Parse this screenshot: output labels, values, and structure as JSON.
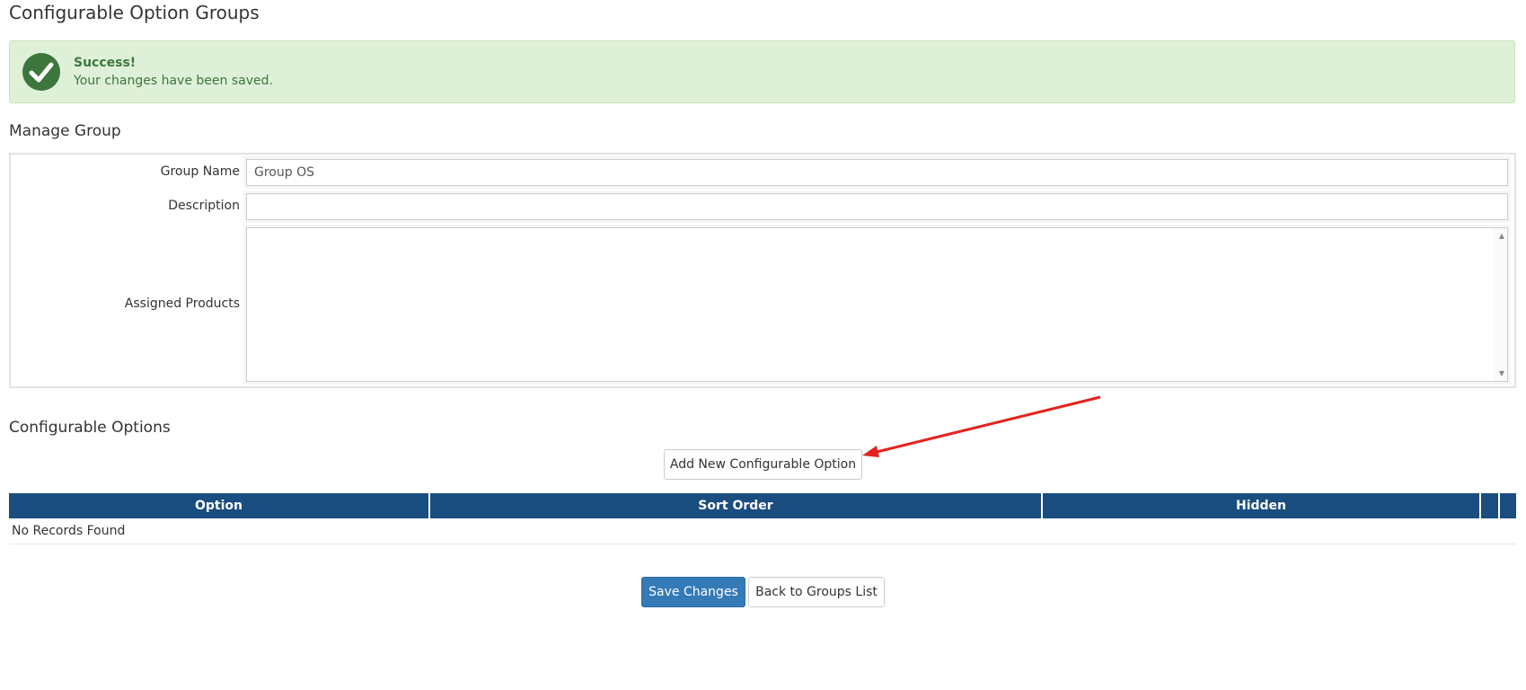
{
  "page": {
    "title": "Configurable Option Groups"
  },
  "alert": {
    "title": "Success!",
    "message": "Your changes have been saved.",
    "icon": "check-circle-icon",
    "color": "#3c763d",
    "background": "#dff0d8"
  },
  "manage_group": {
    "heading": "Manage Group",
    "fields": {
      "group_name": {
        "label": "Group Name",
        "value": "Group OS",
        "placeholder": ""
      },
      "description": {
        "label": "Description",
        "value": "",
        "placeholder": ""
      },
      "assigned_products": {
        "label": "Assigned Products",
        "options": []
      }
    }
  },
  "configurable_options": {
    "heading": "Configurable Options",
    "add_button": "Add New Configurable Option",
    "table": {
      "columns": [
        "Option",
        "Sort Order",
        "Hidden",
        "",
        ""
      ],
      "empty_text": "No Records Found",
      "header_color": "#1a4d80"
    }
  },
  "actions": {
    "save": "Save Changes",
    "back": "Back to Groups List",
    "primary_color": "#337ab7"
  }
}
